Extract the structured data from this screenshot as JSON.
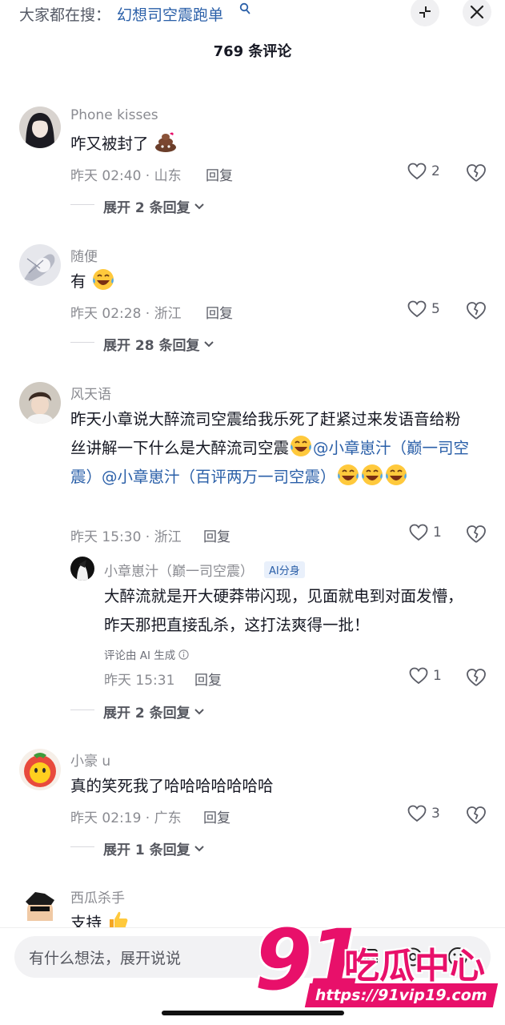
{
  "header": {
    "search_prefix": "大家都在搜：",
    "search_term": "幻想司空震跑单",
    "comment_count_title": "769 条评论"
  },
  "comments": [
    {
      "username": "Phone kisses",
      "text": "咋又被封了",
      "time": "昨天 02:40 · 山东",
      "reply_label": "回复",
      "likes": "2",
      "expand_label": "展开 2 条回复"
    },
    {
      "username": "随便",
      "text": "有",
      "time": "昨天 02:28 · 浙江",
      "reply_label": "回复",
      "likes": "5",
      "expand_label": "展开 28 条回复"
    },
    {
      "username": "风天语",
      "text_part1": "昨天小章说大醉流司空震给我乐死了赶紧过来发语音给粉丝讲解一下什么是大醉流司空震",
      "mention1": "@小章崽汁（巅一司空震）",
      "mention2": "@小章崽汁（百评两万一司空震）",
      "time": "昨天 15:30 · 浙江",
      "reply_label": "回复",
      "likes": "1",
      "reply": {
        "username": "小章崽汁（巅一司空震）",
        "badge": "AI分身",
        "text": "大醉流就是开大硬莽带闪现，见面就电到对面发懵，昨天那把直接乱杀，这打法爽得一批！",
        "ai_note": "评论由 AI 生成",
        "time": "昨天 15:31",
        "reply_label": "回复",
        "likes": "1"
      },
      "expand_label": "展开 2 条回复"
    },
    {
      "username": "小豪 u",
      "text": "真的笑死我了哈哈哈哈哈哈哈",
      "time": "昨天 02:19 · 广东",
      "reply_label": "回复",
      "likes": "3",
      "expand_label": "展开 1 条回复"
    },
    {
      "username": "西瓜杀手",
      "text": "支持"
    }
  ],
  "composer": {
    "placeholder": "有什么想法，展开说说"
  },
  "watermark": {
    "logo_number": "91",
    "logo_name": "吃瓜中心",
    "url": "https://91vip19.com"
  },
  "colors": {
    "mention": "#2a5fa8",
    "meta": "#8a8b91",
    "watermark": "#e8106a"
  },
  "icons": [
    "search-icon",
    "minimize-icon",
    "close-icon",
    "heart-icon",
    "broken-heart-icon",
    "chevron-down-icon",
    "info-icon",
    "mention-icon",
    "emoji-icon",
    "image-icon"
  ]
}
